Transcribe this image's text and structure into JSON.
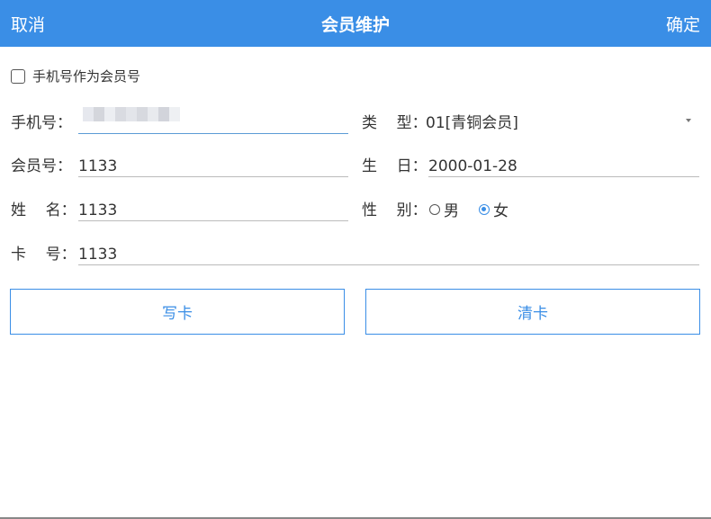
{
  "header": {
    "cancel": "取消",
    "title": "会员维护",
    "confirm": "确定"
  },
  "phone_as_member": {
    "label": "手机号作为会员号",
    "checked": false
  },
  "fields": {
    "phone": {
      "label": "手机号：",
      "value": ""
    },
    "type": {
      "label": "类    型：",
      "value": "01[青铜会员]"
    },
    "member_no": {
      "label": "会员号：",
      "value": "1133"
    },
    "birthday": {
      "label": "生    日：",
      "value": "2000-01-28"
    },
    "name": {
      "label": "姓    名：",
      "value": "1133"
    },
    "gender": {
      "label": "性    别：",
      "options": [
        "男",
        "女"
      ],
      "selected": "女"
    },
    "card_no": {
      "label": "卡    号：",
      "value": "1133"
    }
  },
  "buttons": {
    "write_card": "写卡",
    "clear_card": "清卡"
  },
  "colors": {
    "header_bg": "#3a8ee6",
    "accent": "#3a8ee6"
  }
}
